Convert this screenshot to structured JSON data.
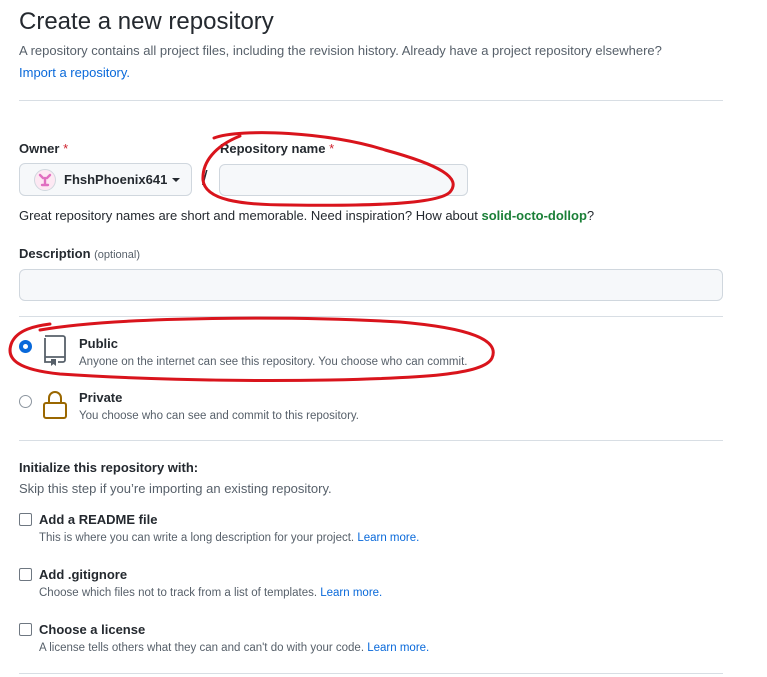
{
  "header": {
    "title": "Create a new repository",
    "subtitle": "A repository contains all project files, including the revision history. Already have a project repository elsewhere?",
    "import_link": "Import a repository."
  },
  "owner": {
    "label": "Owner",
    "required_mark": "*",
    "selected": "FhshPhoenix641",
    "avatar_icon": "identicon-avatar",
    "avatar_color": "#e06fc1"
  },
  "separator": "/",
  "repo_name": {
    "label": "Repository name",
    "required_mark": "*",
    "value": "",
    "hint_prefix": "Great repository names are short and memorable. Need inspiration? How about",
    "suggestion": "solid-octo-dollop",
    "hint_suffix": "?"
  },
  "description": {
    "label": "Description",
    "optional": "(optional)",
    "value": ""
  },
  "visibility": {
    "selected": "public",
    "options": [
      {
        "id": "public",
        "title": "Public",
        "description": "Anyone on the internet can see this repository. You choose who can commit.",
        "icon": "repo-icon"
      },
      {
        "id": "private",
        "title": "Private",
        "description": "You choose who can see and commit to this repository.",
        "icon": "lock-icon"
      }
    ]
  },
  "initialize": {
    "title": "Initialize this repository with:",
    "subtitle": "Skip this step if you’re importing an existing repository.",
    "options": [
      {
        "title": "Add a README file",
        "description": "This is where you can write a long description for your project.",
        "link": "Learn more.",
        "checked": false
      },
      {
        "title": "Add .gitignore",
        "description": "Choose which files not to track from a list of templates.",
        "link": "Learn more.",
        "checked": false
      },
      {
        "title": "Choose a license",
        "description": "A license tells others what they can and can't do with your code.",
        "link": "Learn more.",
        "checked": false
      }
    ]
  },
  "annotations": {
    "color": "#d9141c"
  },
  "colors": {
    "accent": "#0969da",
    "success": "#1a7f37",
    "danger": "#cf222e"
  }
}
